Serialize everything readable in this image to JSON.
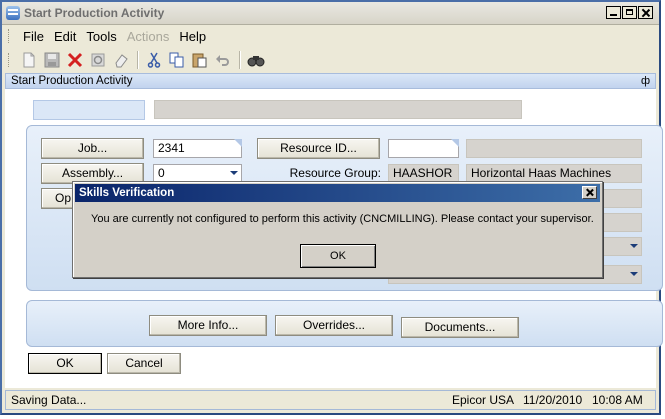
{
  "window": {
    "title": "Start Production Activity"
  },
  "menu": {
    "items": [
      {
        "label": "File",
        "enabled": true
      },
      {
        "label": "Edit",
        "enabled": true
      },
      {
        "label": "Tools",
        "enabled": true
      },
      {
        "label": "Actions",
        "enabled": false
      },
      {
        "label": "Help",
        "enabled": true
      }
    ]
  },
  "toolbar": {
    "icons": [
      "new-icon",
      "save-icon",
      "delete-icon",
      "refresh-icon",
      "clear-icon",
      "cut-icon",
      "copy-icon",
      "paste-icon",
      "undo-icon",
      "search-icon"
    ]
  },
  "panel": {
    "header": "Start Production Activity",
    "pin": "ф"
  },
  "form": {
    "job_button": "Job...",
    "job_value": "2341",
    "assembly_button": "Assembly...",
    "assembly_value": "0",
    "operation_button": "Op",
    "resource_id_button": "Resource ID...",
    "resource_id_value": "",
    "resource_group_label": "Resource Group:",
    "resource_group_code": "HAASHOR",
    "resource_group_desc": "Horizontal Haas Machines"
  },
  "actions": {
    "more_info": "More Info...",
    "overrides": "Overrides...",
    "documents": "Documents..."
  },
  "footer_buttons": {
    "ok": "OK",
    "cancel": "Cancel"
  },
  "status": {
    "left": "Saving Data...",
    "company": "Epicor USA",
    "date": "11/20/2010",
    "time": "10:08 AM"
  },
  "dialog": {
    "title": "Skills Verification",
    "message": "You are currently not configured to perform this activity (CNCMILLING).  Please contact your supervisor.",
    "ok_label": "OK"
  },
  "colors": {
    "accent": "#0a246a",
    "panel_blue": "#dbe7f7",
    "delete_red": "#d42020"
  }
}
